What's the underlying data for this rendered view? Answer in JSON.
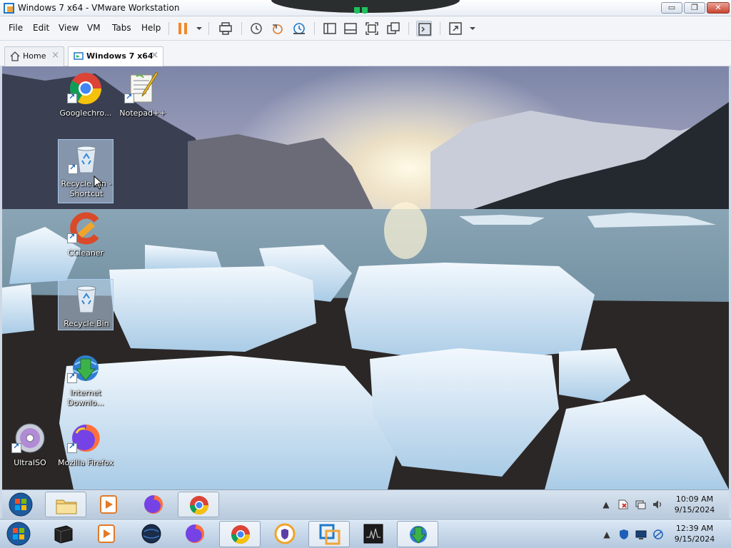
{
  "window": {
    "title": "Windows 7 x64 - VMware Workstation",
    "min_label": "▭",
    "max_label": "❐",
    "close_label": "✕"
  },
  "menu": {
    "items": [
      "File",
      "Edit",
      "View",
      "VM",
      "Tabs",
      "Help"
    ]
  },
  "tabs": [
    {
      "label": "Home",
      "icon": "home-icon",
      "active": false
    },
    {
      "label": "Windows 7 x64",
      "icon": "vm-icon",
      "active": true
    }
  ],
  "desktop": {
    "icons": [
      {
        "label": "Googlechro...",
        "icon": "chrome-icon",
        "shortcut": true,
        "selected": false
      },
      {
        "label": "Notepad++",
        "icon": "notepad-plus-plus-icon",
        "shortcut": true,
        "selected": false
      },
      {
        "label": "Recycle Bin - Shortcut",
        "icon": "recycle-bin-icon",
        "shortcut": true,
        "selected": true
      },
      {
        "label": "CCleaner",
        "icon": "ccleaner-icon",
        "shortcut": true,
        "selected": false
      },
      {
        "label": "Recycle Bin",
        "icon": "recycle-bin-icon",
        "shortcut": false,
        "selected": true
      },
      {
        "label": "Internet Downlo...",
        "icon": "internet-download-manager-icon",
        "shortcut": true,
        "selected": false
      },
      {
        "label": "UltraISO",
        "icon": "ultraiso-icon",
        "shortcut": true,
        "selected": false
      },
      {
        "label": "Mozilla Firefox",
        "icon": "firefox-icon",
        "shortcut": true,
        "selected": false
      }
    ]
  },
  "guest_taskbar": {
    "time": "10:09 AM",
    "date": "9/15/2024",
    "tray_icons": [
      "show-hidden-icon",
      "action-center-icon",
      "network-icon",
      "volume-icon"
    ],
    "apps": [
      "windows-explorer-icon",
      "media-player-icon",
      "firefox-icon",
      "chrome-icon"
    ]
  },
  "host_taskbar": {
    "time": "12:39 AM",
    "date": "9/15/2024",
    "tray_icons": [
      "show-hidden-icon",
      "defender-icon",
      "display-icon",
      "network-icon"
    ],
    "apps": [
      "terminal-box-icon",
      "media-player-icon",
      "globe-app-icon",
      "firefox-icon",
      "chrome-icon",
      "vpn-shield-icon",
      "vmware-icon",
      "monitor-app-icon",
      "internet-download-manager-icon"
    ]
  },
  "colors": {
    "accent": "#1f77c9",
    "pause": "#f08a2c",
    "close": "#c9432f"
  }
}
